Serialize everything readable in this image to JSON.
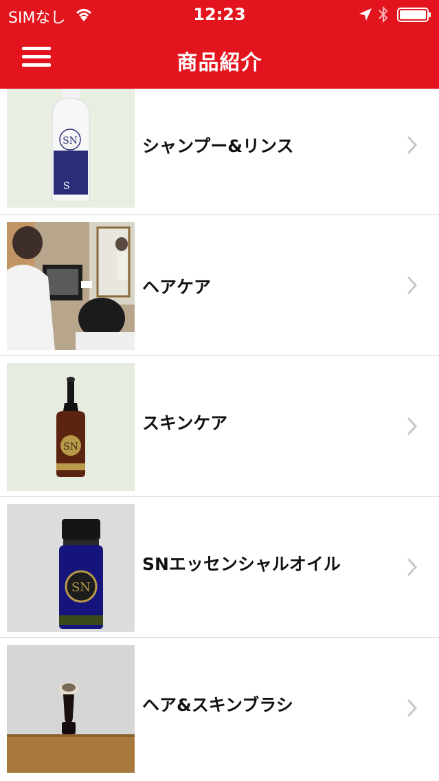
{
  "status_bar": {
    "carrier": "SIMなし",
    "time": "12:23"
  },
  "nav": {
    "title": "商品紹介"
  },
  "products": [
    {
      "label": "シャンプー&リンス"
    },
    {
      "label": "ヘアケア"
    },
    {
      "label": "スキンケア"
    },
    {
      "label": "SNエッセンシャルオイル"
    },
    {
      "label": "ヘア&スキンブラシ"
    }
  ],
  "colors": {
    "header": "#e3141d",
    "chevron": "#c7c7cc",
    "divider": "#d6d6d6"
  }
}
